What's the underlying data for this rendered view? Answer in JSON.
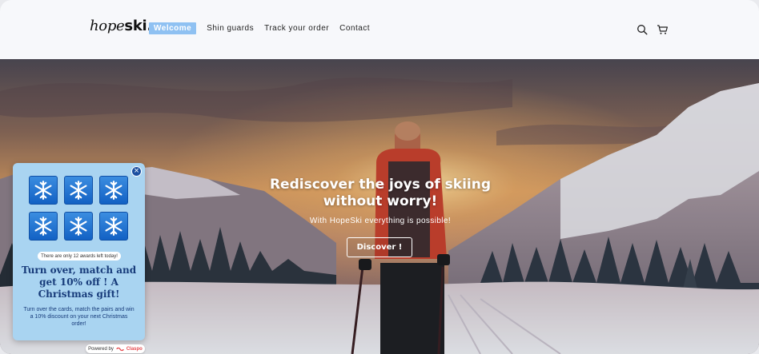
{
  "header": {
    "logo_light": "hope",
    "logo_bold": "ski.",
    "nav": [
      {
        "label": "Welcome",
        "active": true
      },
      {
        "label": "Shin guards",
        "active": false
      },
      {
        "label": "Track your order",
        "active": false
      },
      {
        "label": "Contact",
        "active": false
      }
    ],
    "icons": [
      "search-icon",
      "cart-icon"
    ]
  },
  "hero": {
    "title": "Rediscover the joys of skiing without worry!",
    "subtitle": "With HopeSki everything is possible!",
    "button": "Discover !"
  },
  "popup": {
    "cards": [
      "snowflake-icon",
      "snowflake-icon",
      "snowflake-icon",
      "snowflake-icon",
      "snowflake-icon",
      "snowflake-icon"
    ],
    "awards_text": "There are only 12 awards left today!",
    "title": "Turn over, match and get 10% off ! A Christmas gift!",
    "description": "Turn over the cards, match the pairs and win a 10% discount on your next Christmas order!",
    "close": "×"
  },
  "powered": {
    "prefix": "Powered by",
    "brand": "Claspo"
  },
  "colors": {
    "accent": "#8fc1f2",
    "popup_bg": "#a9d4f1",
    "card_blue": "#1261c4",
    "popup_text": "#173b7a"
  }
}
